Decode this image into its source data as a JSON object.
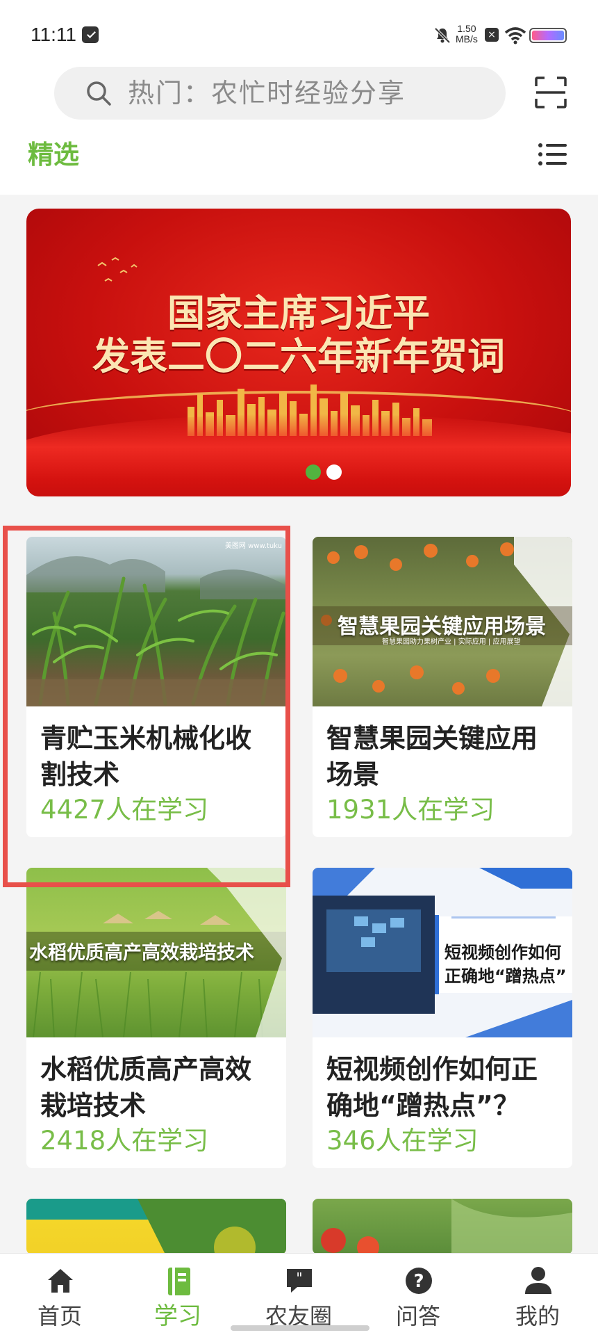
{
  "status_bar": {
    "time": "11:11",
    "net_speed_value": "1.50",
    "net_speed_unit": "MB/s",
    "battery_colors": [
      "#ff5c8a",
      "#b36bff",
      "#6a8cff"
    ]
  },
  "search": {
    "placeholder": "热门：农忙时经验分享"
  },
  "header": {
    "selected_tab": "精选"
  },
  "banner": {
    "title_line1": "国家主席习近平",
    "title_line2": "发表二〇二六年新年贺词",
    "slide_count": 2,
    "active_slide": 1
  },
  "cards": [
    {
      "title": "青贮玉米机械化收割技术",
      "learners": "4427人在学习",
      "thumb_watermark": "美图网 www.tuku"
    },
    {
      "title": "智慧果园关键应用场景",
      "learners": "1931人在学习",
      "thumb_overlay": "智慧果园关键应用场景",
      "thumb_overlay_sub": "智慧果园助力果树产业 | 实际应用 | 应用展望"
    },
    {
      "title": "水稻优质高产高效栽培技术",
      "learners": "2418人在学习",
      "thumb_overlay": "水稻优质高产高效栽培技术"
    },
    {
      "title": "短视频创作如何正确地“蹭热点”？",
      "learners": "346人在学习",
      "thumb_overlay_line1": "短视频创作如何",
      "thumb_overlay_line2": "正确地“蹭热点”"
    }
  ],
  "bottom_nav": [
    {
      "label": "首页",
      "icon": "home-icon"
    },
    {
      "label": "学习",
      "icon": "book-icon",
      "active": true
    },
    {
      "label": "农友圈",
      "icon": "chat-quote-icon"
    },
    {
      "label": "问答",
      "icon": "question-icon"
    },
    {
      "label": "我的",
      "icon": "user-icon"
    }
  ],
  "colors": {
    "accent_green": "#6dbb3f",
    "highlight_red": "#e8504a",
    "banner_red": "#c8100e"
  }
}
